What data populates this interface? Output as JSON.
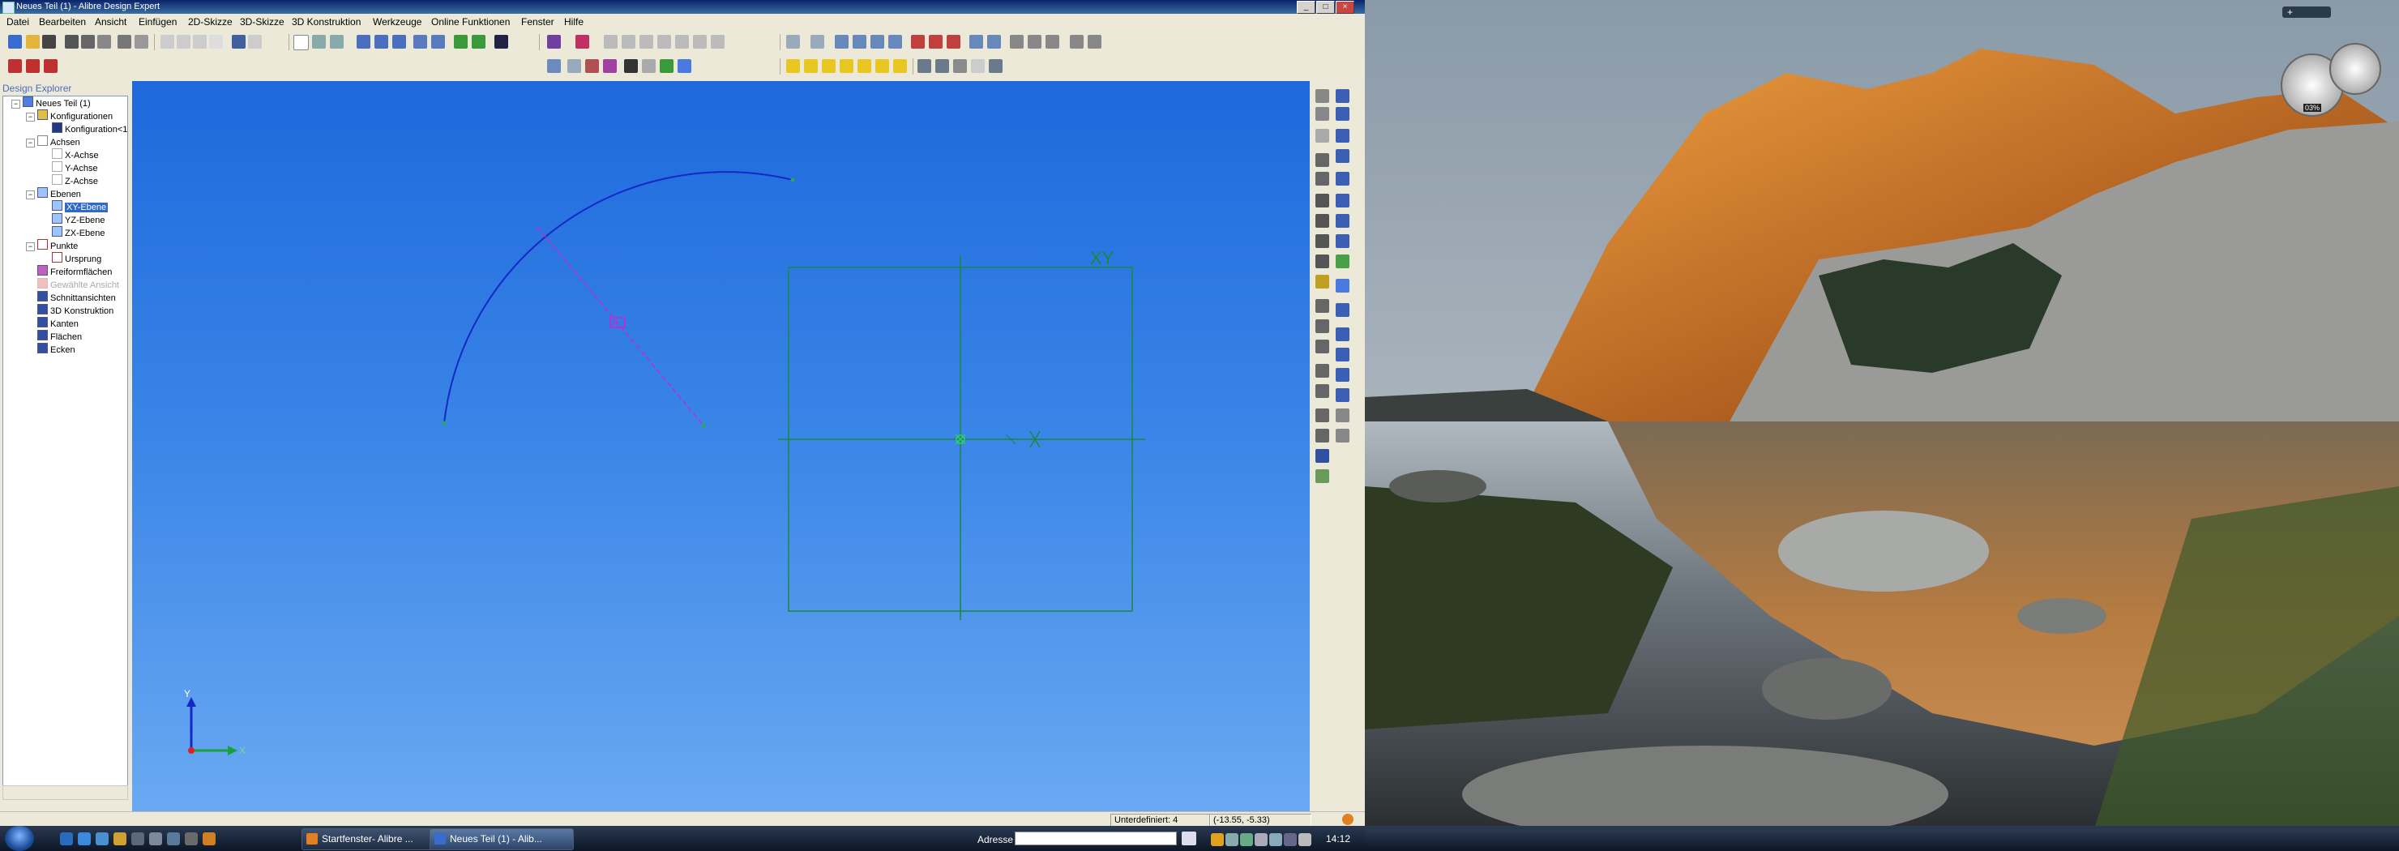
{
  "window": {
    "title": "Neues Teil (1) - Alibre Design Expert"
  },
  "menu": [
    "Datei",
    "Bearbeiten",
    "Ansicht",
    "Einfügen",
    "2D-Skizze",
    "3D-Skizze",
    "3D Konstruktion",
    "Werkzeuge",
    "Online Funktionen",
    "Fenster",
    "Hilfe"
  ],
  "explorer": {
    "header": "Design Explorer",
    "tree": [
      {
        "label": "Neues Teil (1)",
        "level": 0,
        "icon": "part-icon"
      },
      {
        "label": "Konfigurationen",
        "level": 1,
        "icon": "config-folder-icon"
      },
      {
        "label": "Konfiguration<1>",
        "level": 2,
        "icon": "config-icon"
      },
      {
        "label": "Achsen",
        "level": 1,
        "icon": "axes-folder-icon"
      },
      {
        "label": "X-Achse",
        "level": 2,
        "icon": "axis-icon"
      },
      {
        "label": "Y-Achse",
        "level": 2,
        "icon": "axis-icon"
      },
      {
        "label": "Z-Achse",
        "level": 2,
        "icon": "axis-icon"
      },
      {
        "label": "Ebenen",
        "level": 1,
        "icon": "planes-folder-icon"
      },
      {
        "label": "XY-Ebene",
        "level": 2,
        "icon": "plane-icon",
        "selected": true
      },
      {
        "label": "YZ-Ebene",
        "level": 2,
        "icon": "plane-icon"
      },
      {
        "label": "ZX-Ebene",
        "level": 2,
        "icon": "plane-icon"
      },
      {
        "label": "Punkte",
        "level": 1,
        "icon": "points-folder-icon"
      },
      {
        "label": "Ursprung",
        "level": 2,
        "icon": "origin-icon"
      },
      {
        "label": "Freiformflächen",
        "level": 1,
        "icon": "freeform-icon"
      },
      {
        "label": "Gewählte Ansicht",
        "level": 1,
        "icon": "view-icon",
        "dim": true
      },
      {
        "label": "Schnittansichten",
        "level": 1,
        "icon": "section-icon"
      },
      {
        "label": "3D Konstruktion",
        "level": 1,
        "icon": "construction-icon"
      },
      {
        "label": "Kanten",
        "level": 1,
        "icon": "edges-icon"
      },
      {
        "label": "Flächen",
        "level": 1,
        "icon": "faces-icon"
      },
      {
        "label": "Ecken",
        "level": 1,
        "icon": "vertices-icon"
      }
    ]
  },
  "viewport": {
    "plane_label": "XY",
    "triad": {
      "y": "Y",
      "x": "X"
    },
    "dimension_marker": "R"
  },
  "status": {
    "constraint": "Unterdefiniert: 4",
    "coordinates": "(-13.55, -5.33)"
  },
  "taskbar": {
    "tasks": [
      {
        "label": "Startfenster- Alibre ...",
        "active": false
      },
      {
        "label": "Neues Teil (1) - Alib...",
        "active": true
      }
    ],
    "address_label": "Adresse",
    "address_value": "",
    "clock": "14:12"
  },
  "desktop": {
    "gadget_value": "03%"
  },
  "colors": {
    "viewport_top": "#1d69dc",
    "viewport_bottom": "#6aa9f2",
    "sketch_green": "#1a8a3a",
    "arc_blue": "#1428c8",
    "construction_magenta": "#d41fd4"
  }
}
